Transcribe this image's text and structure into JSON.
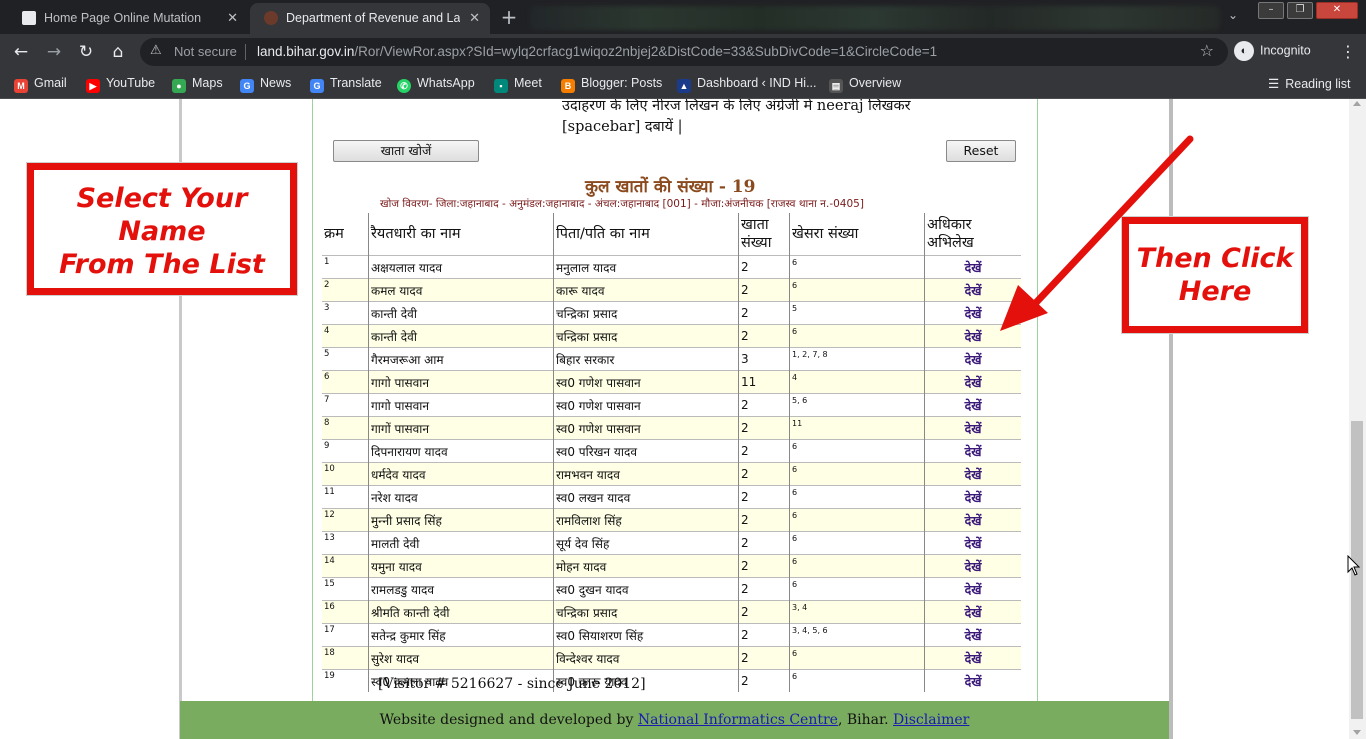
{
  "browser": {
    "tabs": [
      {
        "title": "Home Page Online Mutation",
        "active": false
      },
      {
        "title": "Department of Revenue and Lan",
        "active": true
      }
    ],
    "address": {
      "security": "Not secure",
      "domain": "land.bihar.gov.in",
      "path": "/Ror/ViewRor.aspx?SId=wylq2crfacg1wiqoz2nbjej2&DistCode=33&SubDivCode=1&CircleCode=1"
    },
    "profile_label": "Incognito",
    "bookmarks": [
      "Gmail",
      "YouTube",
      "Maps",
      "News",
      "Translate",
      "WhatsApp",
      "Meet",
      "Blogger: Posts",
      "Dashboard ‹ IND Hi...",
      "Overview"
    ],
    "reading_list": "Reading list"
  },
  "page": {
    "hint_line1": "उदाहरण के लिए नीरज लिखन के लिए अंग्रेजी में neeraj लिखकर",
    "hint_line2": "[spacebar] दबायें |",
    "search_button": "खाता खोजें",
    "reset_button": "Reset",
    "total_label": "कुल खातों की संख्या - 19",
    "details": "खोज विवरण- जिला:जहानाबाद - अनुमंडल:जहानाबाद - अंचल:जहानाबाद [001] - मौजा:अंजनीचक [राजस्व थाना न.-0405]",
    "columns": [
      "क्रम",
      "रैयतधारी का नाम",
      "पिता/पति का नाम",
      "खाता संख्या",
      "खेसरा संख्या",
      "अधिकार अभिलेख"
    ],
    "rows": [
      {
        "sn": "1",
        "name": "अक्षयलाल यादव",
        "father": "मनुलाल यादव",
        "khata": "2",
        "khesra": "6",
        "link": "देखें"
      },
      {
        "sn": "2",
        "name": "कमल यादव",
        "father": "कारू यादव",
        "khata": "2",
        "khesra": "6",
        "link": "देखें"
      },
      {
        "sn": "3",
        "name": "कान्ती देवी",
        "father": "चन्द्रिका प्रसाद",
        "khata": "2",
        "khesra": "5",
        "link": "देखें"
      },
      {
        "sn": "4",
        "name": "कान्ती देवी",
        "father": "चन्द्रिका प्रसाद",
        "khata": "2",
        "khesra": "6",
        "link": "देखें"
      },
      {
        "sn": "5",
        "name": "गैरमजरूआ आम",
        "father": "बिहार सरकार",
        "khata": "3",
        "khesra": "1, 2, 7, 8",
        "link": "देखें"
      },
      {
        "sn": "6",
        "name": "गागो पासवान",
        "father": "स्व0 गणेश पासवान",
        "khata": "11",
        "khesra": "4",
        "link": "देखें"
      },
      {
        "sn": "7",
        "name": "गागो पासवान",
        "father": "स्व0 गणेश पासवान",
        "khata": "2",
        "khesra": "5, 6",
        "link": "देखें"
      },
      {
        "sn": "8",
        "name": "गागों पासवान",
        "father": "स्व0 गणेश पासवान",
        "khata": "2",
        "khesra": "11",
        "link": "देखें"
      },
      {
        "sn": "9",
        "name": "दिपनारायण यादव",
        "father": "स्व0 परिखन यादव",
        "khata": "2",
        "khesra": "6",
        "link": "देखें"
      },
      {
        "sn": "10",
        "name": "धर्मदेव यादव",
        "father": "रामभवन यादव",
        "khata": "2",
        "khesra": "6",
        "link": "देखें"
      },
      {
        "sn": "11",
        "name": "नरेश यादव",
        "father": "स्व0 लखन यादव",
        "khata": "2",
        "khesra": "6",
        "link": "देखें"
      },
      {
        "sn": "12",
        "name": "मुन्‍नी प्रसाद सिंह",
        "father": "रामविलाश सिंह",
        "khata": "2",
        "khesra": "6",
        "link": "देखें"
      },
      {
        "sn": "13",
        "name": "मालती देवी",
        "father": "सूर्य देव सिंह",
        "khata": "2",
        "khesra": "6",
        "link": "देखें"
      },
      {
        "sn": "14",
        "name": "यमुना यादव",
        "father": "मोहन यादव",
        "khata": "2",
        "khesra": "6",
        "link": "देखें"
      },
      {
        "sn": "15",
        "name": "रामलडडु यादव",
        "father": "स्व0 दुखन यादव",
        "khata": "2",
        "khesra": "6",
        "link": "देखें"
      },
      {
        "sn": "16",
        "name": "श्रीमति कान्ती देवी",
        "father": "चन्द्रिका प्रसाद",
        "khata": "2",
        "khesra": "3, 4",
        "link": "देखें"
      },
      {
        "sn": "17",
        "name": "सतेन्द्र कुमार सिंह",
        "father": "स्व0 सियाशरण सिंह",
        "khata": "2",
        "khesra": "3, 4, 5, 6",
        "link": "देखें"
      },
      {
        "sn": "18",
        "name": "सुरेश यादव",
        "father": "विन्देश्वर यादव",
        "khata": "2",
        "khesra": "6",
        "link": "देखें"
      },
      {
        "sn": "19",
        "name": "स्व0 कमला यादव",
        "father": "स्व0 कारू यादव",
        "khata": "2",
        "khesra": "6",
        "link": "देखें"
      }
    ],
    "visitor": "[Visitor #  5216627 - since June 2012]",
    "footer_prefix": "Website designed and developed by ",
    "footer_link": "National Informatics Centre",
    "footer_mid": ", Bihar. ",
    "footer_disclaimer": "Disclaimer"
  },
  "annotations": {
    "left_callout": [
      "Select Your Name",
      "From The List"
    ],
    "right_callout": [
      "Then Click",
      "Here"
    ],
    "accent_color": "#e3100c"
  }
}
